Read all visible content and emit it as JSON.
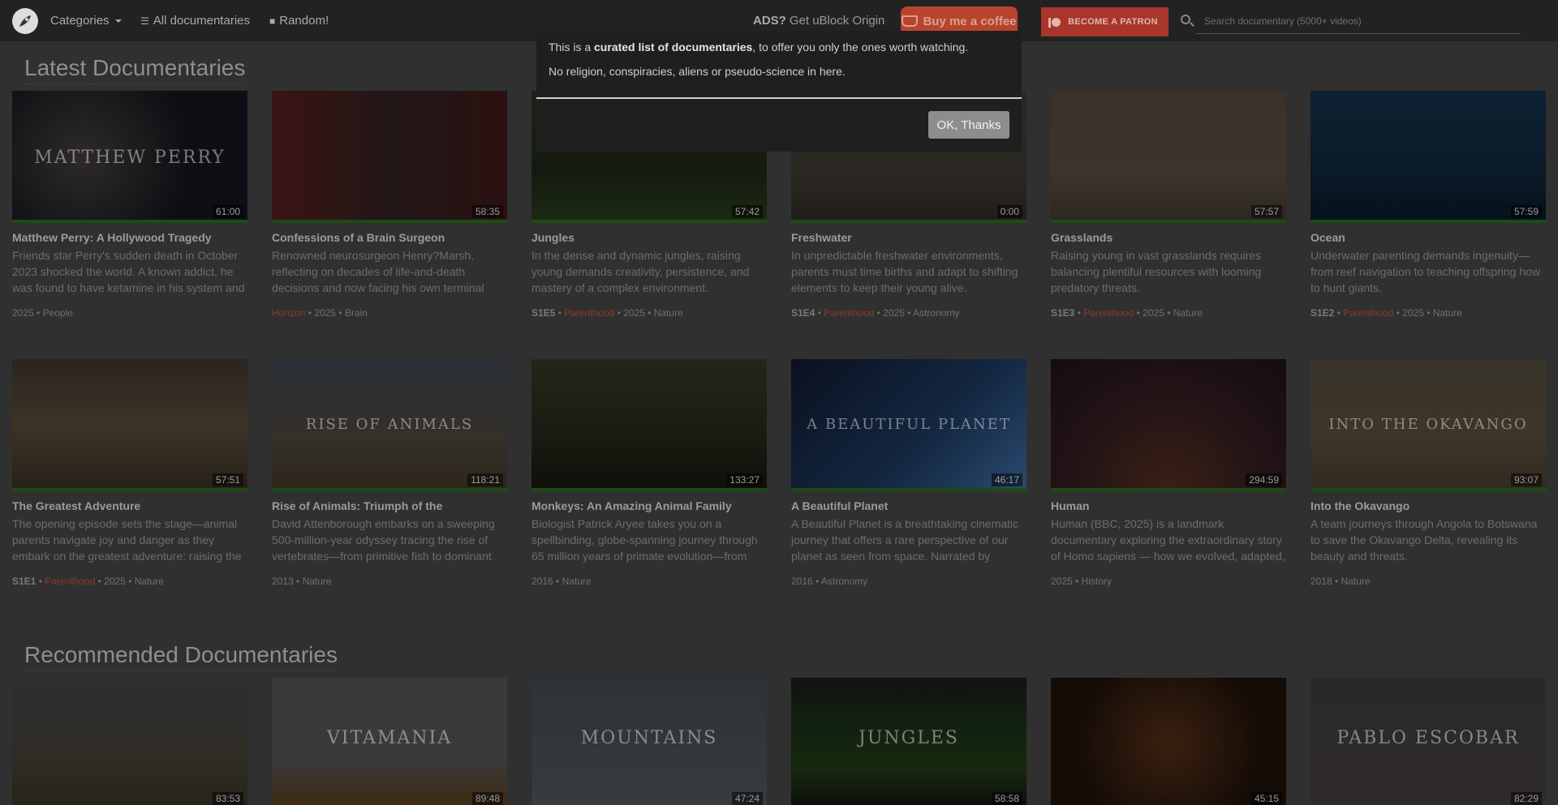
{
  "nav": {
    "categories": "Categories",
    "all_docs": "All documentaries",
    "random": "Random!",
    "ads_label": "ADS?",
    "ads_text": "Get uBlock Origin",
    "coffee": "Buy me a coffee",
    "patron": "BECOME A PATRON",
    "search_placeholder": "Search documentary (5000+ videos)"
  },
  "modal": {
    "line1_pre": "This is a ",
    "line1_bold": "curated list of documentaries",
    "line1_post": ", to offer you only the ones worth watching.",
    "line2": "No religion, conspiracies, aliens or pseudo-science in here.",
    "ok": "OK, Thanks"
  },
  "latest": {
    "heading": "Latest Documentaries",
    "cards": [
      {
        "title": "Matthew Perry: A Hollywood Tragedy",
        "desc": "Friends star Perry's sudden death in October 2023 shocked the world. A known addict, he was found to have ketamine in his system and",
        "duration": "61:00",
        "code": "",
        "series": "",
        "year": "2025",
        "category": "People",
        "thumb_text": "MATTHEW PERRY"
      },
      {
        "title": "Confessions of a Brain Surgeon",
        "desc": "Renowned neurosurgeon Henry?Marsh, reflecting on decades of life-and-death decisions and now facing his own terminal",
        "duration": "58:35",
        "code": "",
        "series": "Horizon",
        "year": "2025",
        "category": "Brain",
        "thumb_text": ""
      },
      {
        "title": "Jungles",
        "desc": "In the dense and dynamic jungles, raising young demands creativity, persistence, and mastery of a complex environment.",
        "duration": "57:42",
        "code": "S1E5",
        "series": "Parenthood",
        "year": "2025",
        "category": "Nature",
        "thumb_text": ""
      },
      {
        "title": "Freshwater",
        "desc": "In unpredictable freshwater environments, parents must time births and adapt to shifting elements to keep their young alive.",
        "duration": "0:00",
        "code": "S1E4",
        "series": "Parenthood",
        "year": "2025",
        "category": "Astronomy",
        "thumb_text": ""
      },
      {
        "title": "Grasslands",
        "desc": "Raising young in vast grasslands requires balancing plentiful resources with looming predatory threats.",
        "duration": "57:57",
        "code": "S1E3",
        "series": "Parenthood",
        "year": "2025",
        "category": "Nature",
        "thumb_text": ""
      },
      {
        "title": "Ocean",
        "desc": "Underwater parenting demands ingenuity—from reef navigation to teaching offspring how to hunt giants.",
        "duration": "57:59",
        "code": "S1E2",
        "series": "Parenthood",
        "year": "2025",
        "category": "Nature",
        "thumb_text": ""
      },
      {
        "title": "The Greatest Adventure",
        "desc": "The opening episode sets the stage—animal parents navigate joy and danger as they embark on the greatest adventure: raising the",
        "duration": "57:51",
        "code": "S1E1",
        "series": "Parenthood",
        "year": "2025",
        "category": "Nature",
        "thumb_text": ""
      },
      {
        "title": "Rise of Animals: Triumph of the",
        "desc": "David Attenborough embarks on a sweeping 500-million-year odyssey tracing the rise of vertebrates—from primitive fish to dominant",
        "duration": "118:21",
        "code": "",
        "series": "",
        "year": "2013",
        "category": "Nature",
        "thumb_text": "RISE OF ANIMALS"
      },
      {
        "title": "Monkeys: An Amazing Animal Family",
        "desc": "Biologist Patrick Aryee takes you on a spellbinding, globe-spanning journey through 65 million years of primate evolution—from",
        "duration": "133:27",
        "code": "",
        "series": "",
        "year": "2016",
        "category": "Nature",
        "thumb_text": ""
      },
      {
        "title": "A Beautiful Planet",
        "desc": "A Beautiful Planet is a breathtaking cinematic journey that offers a rare perspective of our planet as seen from space. Narrated by",
        "duration": "46:17",
        "code": "",
        "series": "",
        "year": "2016",
        "category": "Astronomy",
        "thumb_text": "A BEAUTIFUL PLANET"
      },
      {
        "title": "Human",
        "desc": "Human (BBC, 2025) is a landmark documentary exploring the extraordinary story of Homo sapiens — how we evolved, adapted,",
        "duration": "294:59",
        "code": "",
        "series": "",
        "year": "2025",
        "category": "History",
        "thumb_text": ""
      },
      {
        "title": "Into the Okavango",
        "desc": "A team journeys through Angola to Botswana to save the Okavango Delta, revealing its beauty and threats.",
        "duration": "93:07",
        "code": "",
        "series": "",
        "year": "2018",
        "category": "Nature",
        "thumb_text": "INTO THE OKAVANGO"
      }
    ]
  },
  "recommended": {
    "heading": "Recommended Documentaries",
    "cards": [
      {
        "duration": "83:53",
        "thumb_text": ""
      },
      {
        "duration": "89:48",
        "thumb_text": "VITAMANIA"
      },
      {
        "duration": "47:24",
        "thumb_text": "MOUNTAINS"
      },
      {
        "duration": "58:58",
        "thumb_text": "JUNGLES"
      },
      {
        "duration": "45:15",
        "thumb_text": ""
      },
      {
        "duration": "82:29",
        "thumb_text": "PABLO ESCOBAR"
      }
    ]
  }
}
